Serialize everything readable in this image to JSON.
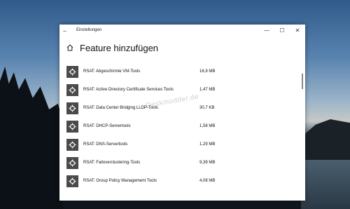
{
  "window": {
    "title": "Einstellungen",
    "minimize_glyph": "—",
    "maximize_glyph": "☐",
    "close_glyph": "✕"
  },
  "page": {
    "title": "Feature hinzufügen"
  },
  "features": [
    {
      "name": "RSAT: Abgeschirmte VM-Tools",
      "size": "16,9 MB"
    },
    {
      "name": "RSAT: Active Directory Certificate Services Tools",
      "size": "1,47 MB"
    },
    {
      "name": "RSAT: Data Center Bridging LLDP-Tools",
      "size": "30,7 KB"
    },
    {
      "name": "RSAT: DHCP-Servertools",
      "size": "1,58 MB"
    },
    {
      "name": "RSAT: DNS-Servertools",
      "size": "1,29 MB"
    },
    {
      "name": "RSAT: Failoverclustering-Tools",
      "size": "9,39 MB"
    },
    {
      "name": "RSAT: Group Policy Management Tools",
      "size": "4,08 MB"
    }
  ],
  "watermark": "Deskmodder.de",
  "icons": {
    "back": "back-arrow-icon",
    "home": "home-icon",
    "feature": "puzzle-gear-icon"
  }
}
